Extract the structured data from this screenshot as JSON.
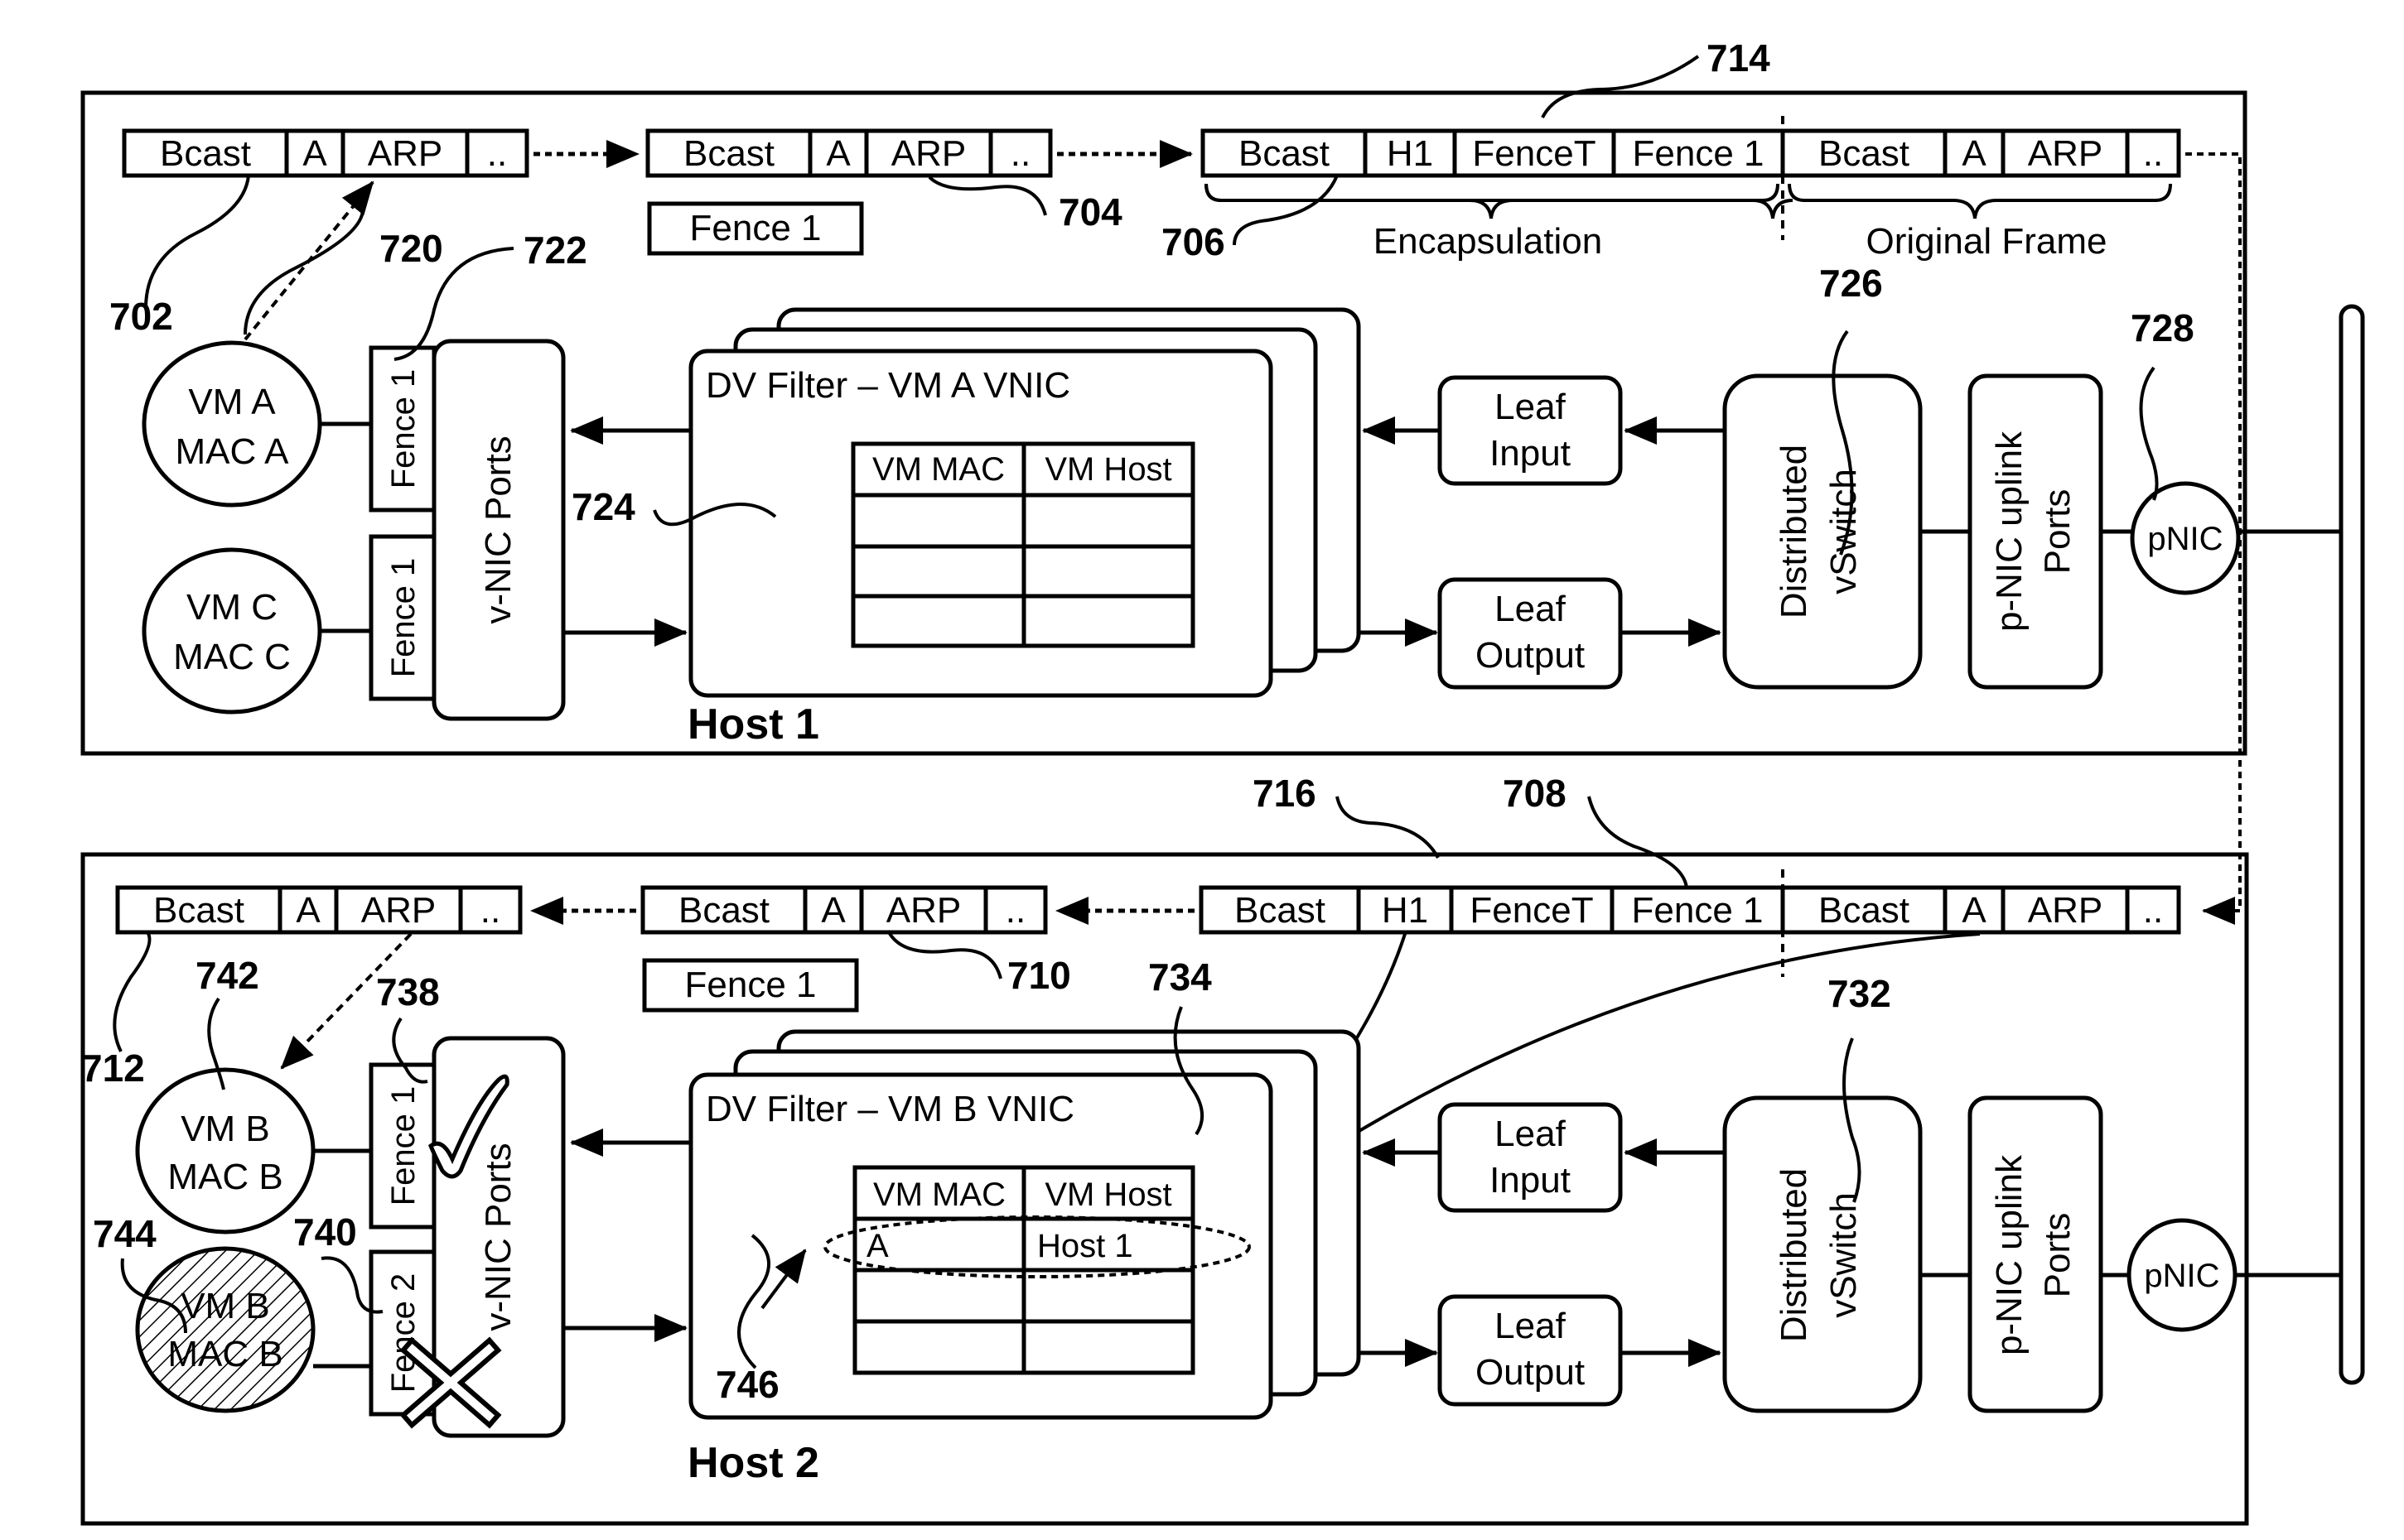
{
  "colors": {
    "stroke": "#000000",
    "background": "#ffffff"
  },
  "host1": {
    "title": "Host 1",
    "frame_702": [
      "Bcast",
      "A",
      "ARP",
      ".."
    ],
    "frame_704": [
      "Bcast",
      "A",
      "ARP",
      ".."
    ],
    "fence_tag": "Fence 1",
    "frame_706": [
      "Bcast",
      "H1",
      "FenceT",
      "Fence 1",
      "Bcast",
      "A",
      "ARP",
      ".."
    ],
    "encapsulation_label": "Encapsulation",
    "original_frame_label": "Original Frame",
    "vm_a": [
      "VM A",
      "MAC A"
    ],
    "vm_c": [
      "VM C",
      "MAC C"
    ],
    "fence_a": "Fence 1",
    "fence_c": "Fence 1",
    "vnic_ports": "v-NIC Ports",
    "dv_filter": "DV Filter – VM A VNIC",
    "table_headers": [
      "VM MAC",
      "VM Host"
    ],
    "table_rows": [
      [
        "",
        ""
      ],
      [
        "",
        ""
      ],
      [
        "",
        ""
      ]
    ],
    "leaf_input": [
      "Leaf",
      "Input"
    ],
    "leaf_output": [
      "Leaf",
      "Output"
    ],
    "vswitch": [
      "Distributed",
      "vSwitch"
    ],
    "uplink": [
      "p-NIC uplink",
      "Ports"
    ],
    "pnic": "pNIC",
    "refs": {
      "r702": "702",
      "r704": "704",
      "r706": "706",
      "r714": "714",
      "r720": "720",
      "r722": "722",
      "r724": "724",
      "r726": "726",
      "r728": "728"
    }
  },
  "host2": {
    "title": "Host 2",
    "frame_712": [
      "Bcast",
      "A",
      "ARP",
      ".."
    ],
    "frame_710": [
      "Bcast",
      "A",
      "ARP",
      ".."
    ],
    "fence_tag": "Fence 1",
    "frame_708": [
      "Bcast",
      "H1",
      "FenceT",
      "Fence 1",
      "Bcast",
      "A",
      "ARP",
      ".."
    ],
    "vm_b": [
      "VM B",
      "MAC B"
    ],
    "vm_b_blocked": [
      "VM B",
      "MAC B"
    ],
    "fence_b": "Fence 1",
    "fence_b2": "Fence 2",
    "vnic_ports": "v-NIC Ports",
    "dv_filter": "DV Filter – VM B VNIC",
    "table_headers": [
      "VM MAC",
      "VM Host"
    ],
    "table_rows": [
      [
        "A",
        "Host 1"
      ],
      [
        "",
        ""
      ],
      [
        "",
        ""
      ]
    ],
    "leaf_input": [
      "Leaf",
      "Input"
    ],
    "leaf_output": [
      "Leaf",
      "Output"
    ],
    "vswitch": [
      "Distributed",
      "vSwitch"
    ],
    "uplink": [
      "p-NIC uplink",
      "Ports"
    ],
    "pnic": "pNIC",
    "refs": {
      "r708": "708",
      "r710": "710",
      "r712": "712",
      "r716": "716",
      "r732": "732",
      "r734": "734",
      "r738": "738",
      "r740": "740",
      "r742": "742",
      "r744": "744",
      "r746": "746"
    }
  }
}
